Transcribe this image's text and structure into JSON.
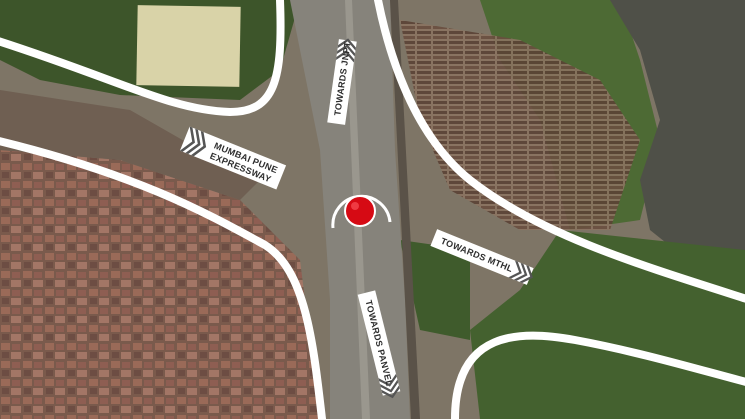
{
  "map": {
    "labels": {
      "towards_jnpt": "TOWARDS JNPT",
      "mumbai_pune_line1": "MUMBAI PUNE",
      "mumbai_pune_line2": "EXPRESSWAY",
      "towards_mthl": "TOWARDS MTHL",
      "towards_panvel": "TOWARDS PANVEL"
    },
    "marker": {
      "type": "location-marker",
      "color": "#d60a14"
    },
    "colors": {
      "road_overlay": "#ffffff",
      "marker": "#d60a14",
      "vegetation": "#3f5b2c",
      "water": "#4d4f45",
      "highway": "#85827a"
    }
  }
}
